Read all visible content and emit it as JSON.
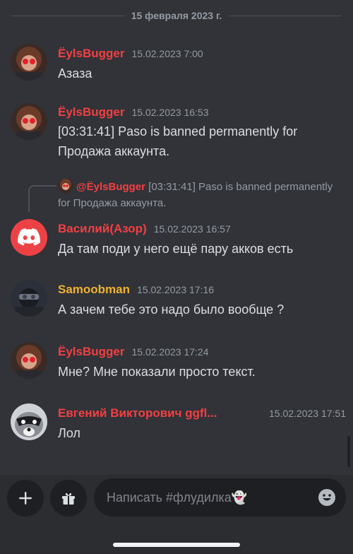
{
  "date_divider": "15 февраля 2023 г.",
  "colors": {
    "background": "#313338",
    "red_user": "#f23f43",
    "gold_user": "#f0b232",
    "muted": "#949ba4",
    "discord_blurple": "#ed4245"
  },
  "messages": [
    {
      "username": "ËylsBugger",
      "timestamp": "15.02.2023 7:00",
      "text": "Азаза"
    },
    {
      "username": "ËylsBugger",
      "timestamp": "15.02.2023 16:53",
      "text": "[03:31:41] Paso is banned permanently for Продажа аккаунта."
    },
    {
      "username": "Василий(Азор)",
      "timestamp": "15.02.2023 16:57",
      "text": "Да там поди у него ещё пару акков есть",
      "reply": {
        "mention": "@ËylsBugger",
        "text": " [03:31:41] Paso is banned permanently for Продажа аккаунта."
      }
    },
    {
      "username": "Samoobman",
      "timestamp": "15.02.2023 17:16",
      "text": "А зачем тебе это надо было вообще ?"
    },
    {
      "username": "ËylsBugger",
      "timestamp": "15.02.2023 17:24",
      "text": "Мне? Мне показали просто текст."
    },
    {
      "username": "Евгений Викторович ggfl...",
      "timestamp": "15.02.2023 17:51",
      "text": "Лол"
    }
  ],
  "composer": {
    "placeholder": "Написать #флудилка👻",
    "icons": [
      "plus-icon",
      "gift-icon",
      "emoji-icon"
    ]
  }
}
